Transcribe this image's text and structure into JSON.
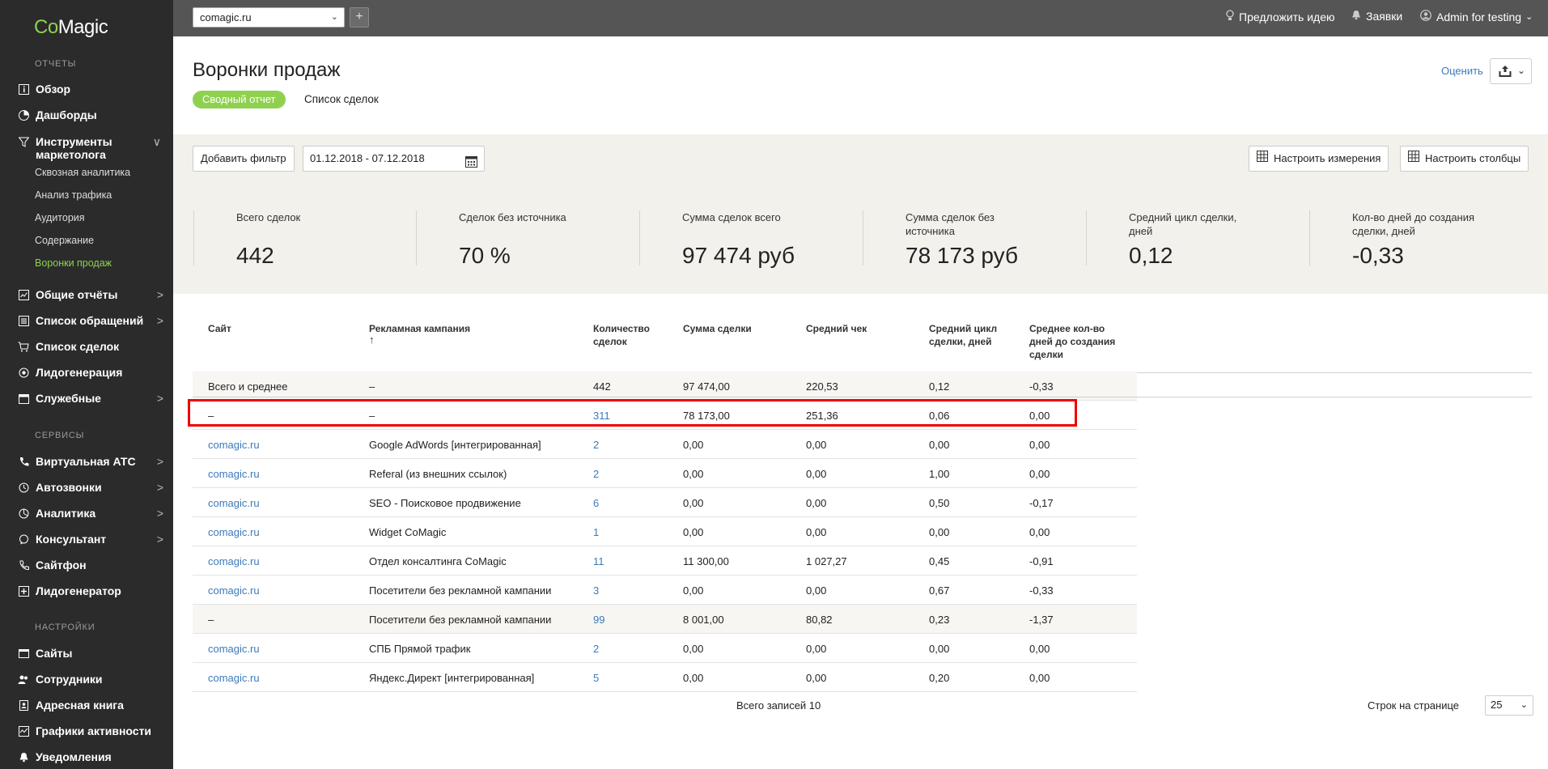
{
  "app": {
    "logo_co": "Co",
    "logo_magic": "Magic"
  },
  "sidebar": {
    "sections": {
      "reports": "ОТЧЕТЫ",
      "services": "СЕРВИСЫ",
      "settings": "НАСТРОЙКИ"
    },
    "items": [
      {
        "label": "Обзор",
        "icon": "info-icon"
      },
      {
        "label": "Дашборды",
        "icon": "pie-icon"
      },
      {
        "label": "Инструменты маркетолога",
        "icon": "filter-icon"
      },
      {
        "label": "Общие отчёты",
        "icon": "chart-icon"
      },
      {
        "label": "Список обращений",
        "icon": "list-icon"
      },
      {
        "label": "Список сделок",
        "icon": "cart-icon"
      },
      {
        "label": "Лидогенерация",
        "icon": "target-icon"
      },
      {
        "label": "Служебные",
        "icon": "calendar-icon"
      },
      {
        "label": "Виртуальная АТС",
        "icon": "phone-icon"
      },
      {
        "label": "Автозвонки",
        "icon": "autocall-icon"
      },
      {
        "label": "Аналитика",
        "icon": "analytics-icon"
      },
      {
        "label": "Консультант",
        "icon": "chat-icon"
      },
      {
        "label": "Сайтфон",
        "icon": "sitephone-icon"
      },
      {
        "label": "Лидогенератор",
        "icon": "leadgen-icon"
      },
      {
        "label": "Сайты",
        "icon": "sites-icon"
      },
      {
        "label": "Сотрудники",
        "icon": "users-icon"
      },
      {
        "label": "Адресная книга",
        "icon": "book-icon"
      },
      {
        "label": "Графики активности",
        "icon": "activity-icon"
      },
      {
        "label": "Уведомления",
        "icon": "bell-icon"
      }
    ],
    "subitems": [
      "Сквозная аналитика",
      "Анализ трафика",
      "Аудитория",
      "Содержание",
      "Воронки продаж"
    ],
    "chevron_down": "∨",
    "chevron_right": ">"
  },
  "topbar": {
    "site": "comagic.ru",
    "suggest": "Предложить идею",
    "requests": "Заявки",
    "user": "Admin for testing"
  },
  "header": {
    "title": "Воронки продаж",
    "tab_summary": "Сводный отчет",
    "tab_deals": "Список сделок",
    "rate": "Оценить"
  },
  "filters": {
    "add_filter": "Добавить фильтр",
    "date_range": "01.12.2018 - 07.12.2018",
    "configure_dimensions": "Настроить измерения",
    "configure_columns": "Настроить столбцы"
  },
  "kpis": [
    {
      "label": "Всего сделок",
      "value": "442"
    },
    {
      "label": "Сделок без источника",
      "value": "70 %"
    },
    {
      "label": "Сумма сделок всего",
      "value": "97 474 руб"
    },
    {
      "label": "Сумма сделок без источника",
      "value": "78 173 руб"
    },
    {
      "label": "Средний цикл сделки, дней",
      "value": "0,12"
    },
    {
      "label": "Кол-во дней до создания сделки, дней",
      "value": "-0,33"
    }
  ],
  "table": {
    "headers": [
      "Сайт",
      "Рекламная кампания",
      "Количество сделок",
      "Сумма сделки",
      "Средний чек",
      "Средний цикл сделки, дней",
      "Среднее кол-во дней до создания сделки"
    ],
    "sort_arrow": "↑",
    "total": [
      "Всего и среднее",
      "–",
      "442",
      "97 474,00",
      "220,53",
      "0,12",
      "-0,33"
    ],
    "rows": [
      [
        "–",
        "–",
        "311",
        "78 173,00",
        "251,36",
        "0,06",
        "0,00"
      ],
      [
        "comagic.ru",
        "Google AdWords [интегрированная]",
        "2",
        "0,00",
        "0,00",
        "0,00",
        "0,00"
      ],
      [
        "comagic.ru",
        "Referal (из внешних ссылок)",
        "2",
        "0,00",
        "0,00",
        "1,00",
        "0,00"
      ],
      [
        "comagic.ru",
        "SEO - Поисковое продвижение",
        "6",
        "0,00",
        "0,00",
        "0,50",
        "-0,17"
      ],
      [
        "comagic.ru",
        "Widget CoMagic",
        "1",
        "0,00",
        "0,00",
        "0,00",
        "0,00"
      ],
      [
        "comagic.ru",
        "Отдел консалтинга CoMagic",
        "11",
        "11 300,00",
        "1 027,27",
        "0,45",
        "-0,91"
      ],
      [
        "comagic.ru",
        "Посетители без рекламной кампании",
        "3",
        "0,00",
        "0,00",
        "0,67",
        "-0,33"
      ],
      [
        "–",
        "Посетители без рекламной кампании",
        "99",
        "8 001,00",
        "80,82",
        "0,23",
        "-1,37"
      ],
      [
        "comagic.ru",
        "СПБ Прямой трафик",
        "2",
        "0,00",
        "0,00",
        "0,00",
        "0,00"
      ],
      [
        "comagic.ru",
        "Яндекс.Директ [интегрированная]",
        "5",
        "0,00",
        "0,00",
        "0,20",
        "0,00"
      ]
    ]
  },
  "footer": {
    "total_records": "Всего записей 10",
    "rows_per_page": "Строк на странице",
    "per_page_value": "25"
  }
}
